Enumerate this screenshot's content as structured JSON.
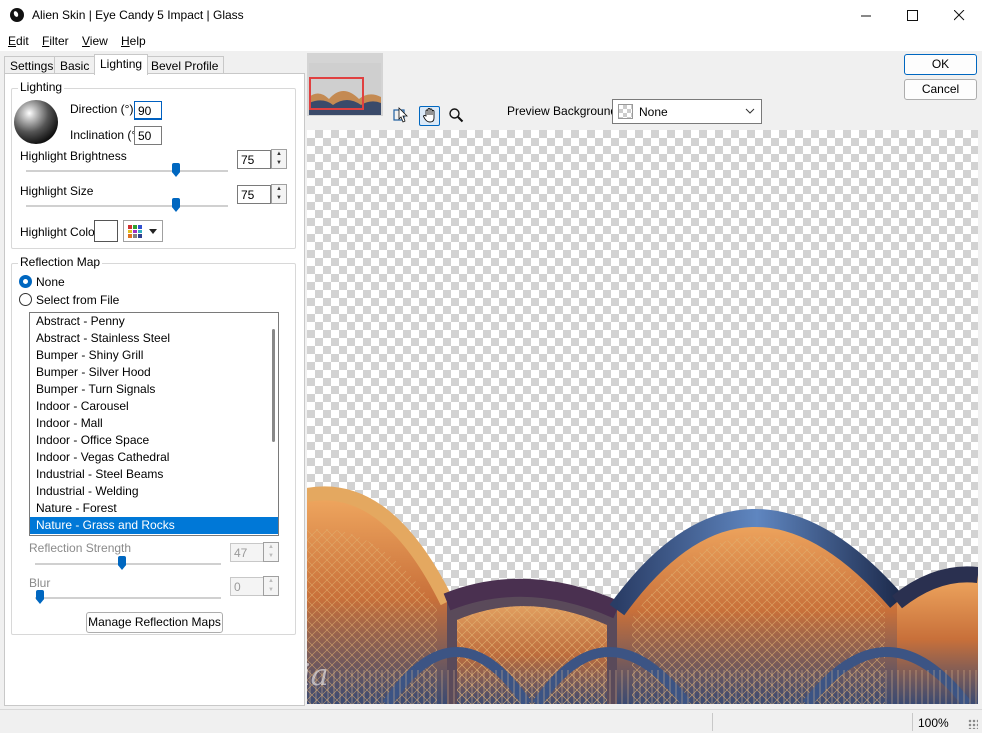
{
  "window": {
    "title": "Alien Skin | Eye Candy 5 Impact | Glass"
  },
  "menu": [
    {
      "underline": "E",
      "rest": "dit"
    },
    {
      "underline": "F",
      "rest": "ilter"
    },
    {
      "underline": "V",
      "rest": "iew"
    },
    {
      "underline": "H",
      "rest": "elp"
    }
  ],
  "tabs": [
    "Settings",
    "Basic",
    "Lighting",
    "Bevel Profile"
  ],
  "active_tab": "Lighting",
  "lighting": {
    "group_title": "Lighting",
    "direction_label": "Direction (°)",
    "direction_value": "90",
    "inclination_label": "Inclination (°)",
    "inclination_value": "50",
    "highlight_brightness_label": "Highlight Brightness",
    "highlight_brightness_value": "75",
    "highlight_size_label": "Highlight Size",
    "highlight_size_value": "75",
    "highlight_color_label": "Highlight Color",
    "highlight_color": "#ffffff"
  },
  "reflection": {
    "group_title": "Reflection Map",
    "option_none": "None",
    "option_file": "Select from File",
    "selected_option": "None",
    "maps": [
      "Abstract - Penny",
      "Abstract - Stainless Steel",
      "Bumper - Shiny Grill",
      "Bumper - Silver Hood",
      "Bumper - Turn Signals",
      "Indoor - Carousel",
      "Indoor - Mall",
      "Indoor - Office Space",
      "Indoor - Vegas Cathedral",
      "Industrial - Steel Beams",
      "Industrial - Welding",
      "Nature - Forest",
      "Nature - Grass and Rocks"
    ],
    "selected_map": "Nature - Grass and Rocks",
    "strength_label": "Reflection Strength",
    "strength_value": "47",
    "blur_label": "Blur",
    "blur_value": "0",
    "manage_button": "Manage Reflection Maps"
  },
  "buttons": {
    "ok": "OK",
    "cancel": "Cancel"
  },
  "toolbar": {
    "tools": [
      "navigate-icon",
      "hand-icon",
      "zoom-icon"
    ],
    "active_tool": "hand-icon"
  },
  "preview_background": {
    "label": "Preview Background:",
    "value": "None"
  },
  "status": {
    "zoom": "100%"
  },
  "colors": {
    "accent": "#0067c0",
    "selection": "#0078d7",
    "thumb_frame": "#e04040"
  }
}
